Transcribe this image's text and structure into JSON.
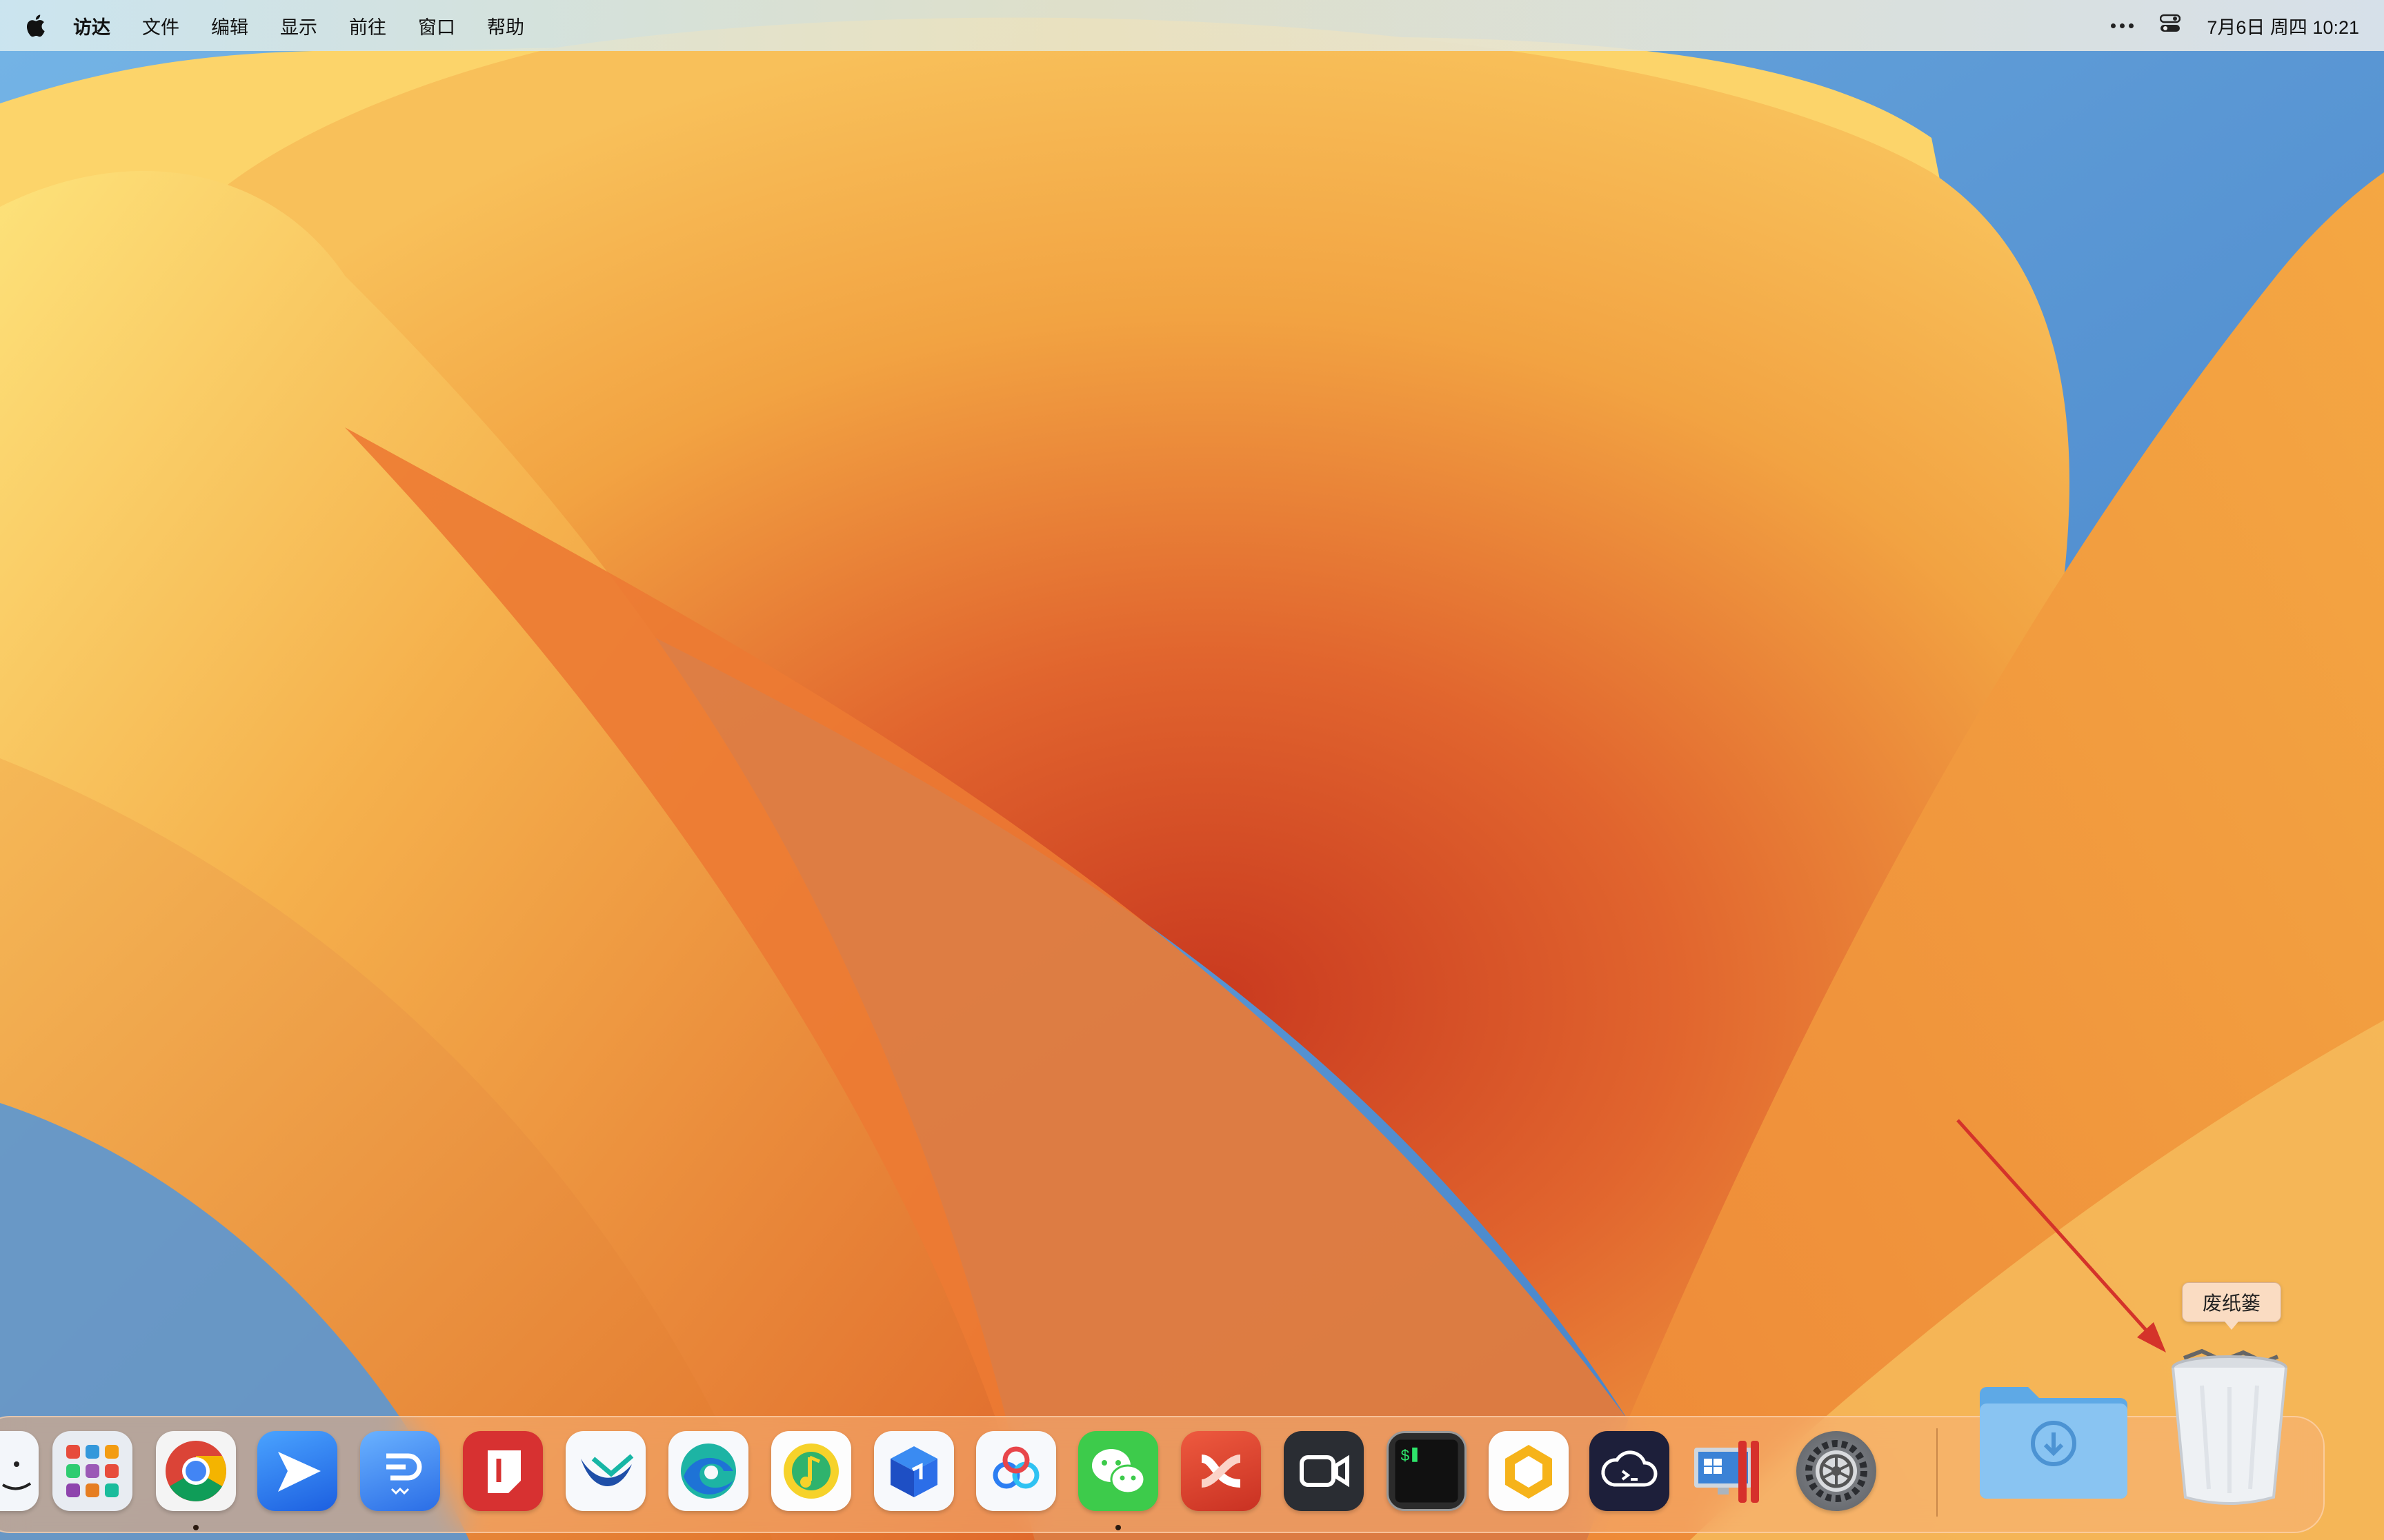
{
  "menubar": {
    "apple": "apple-logo",
    "items": [
      "访达",
      "文件",
      "编辑",
      "显示",
      "前往",
      "窗口",
      "帮助"
    ],
    "status": {
      "more": "more-icon",
      "control_center": "control-center-icon",
      "datetime": "7月6日 周四  10:21"
    }
  },
  "dock": {
    "apps": [
      {
        "name": "Finder",
        "icon": "finder-icon",
        "running": false
      },
      {
        "name": "Launchpad",
        "icon": "launchpad-icon",
        "running": false
      },
      {
        "name": "Google Chrome",
        "icon": "chrome-icon",
        "running": true
      },
      {
        "name": "Feishu",
        "icon": "paper-plane-icon",
        "running": false
      },
      {
        "name": "Note App",
        "icon": "note-app-icon",
        "running": false
      },
      {
        "name": "Red App",
        "icon": "red-app-icon",
        "running": false
      },
      {
        "name": "Mail App",
        "icon": "bird-mail-icon",
        "running": false
      },
      {
        "name": "Microsoft Edge",
        "icon": "edge-icon",
        "running": false
      },
      {
        "name": "QQ Music",
        "icon": "music-icon",
        "running": false
      },
      {
        "name": "Box App",
        "icon": "box-icon",
        "running": false
      },
      {
        "name": "Baidu Netdisk",
        "icon": "cloud-drive-icon",
        "running": false
      },
      {
        "name": "WeChat",
        "icon": "wechat-icon",
        "running": true
      },
      {
        "name": "XMind",
        "icon": "xmind-icon",
        "running": false
      },
      {
        "name": "Video App",
        "icon": "video-camera-icon",
        "running": false
      },
      {
        "name": "Terminal",
        "icon": "terminal-icon",
        "running": false
      },
      {
        "name": "Hexagon App",
        "icon": "hexagon-icon",
        "running": false
      },
      {
        "name": "SSH App",
        "icon": "cloud-terminal-icon",
        "running": false
      },
      {
        "name": "Parallels Desktop",
        "icon": "parallels-icon",
        "running": false
      },
      {
        "name": "System Settings",
        "icon": "gear-icon",
        "running": false
      }
    ],
    "downloads": {
      "name": "Downloads",
      "icon": "downloads-folder-icon"
    },
    "trash": {
      "name": "Trash",
      "icon": "trash-icon",
      "tooltip": "废纸篓"
    }
  },
  "colors": {
    "wallpaper_main": "#f2a041",
    "wallpaper_deep": "#cf4a25",
    "wallpaper_sky": "#6fa8dc",
    "annotation_arrow": "#d4332a"
  }
}
